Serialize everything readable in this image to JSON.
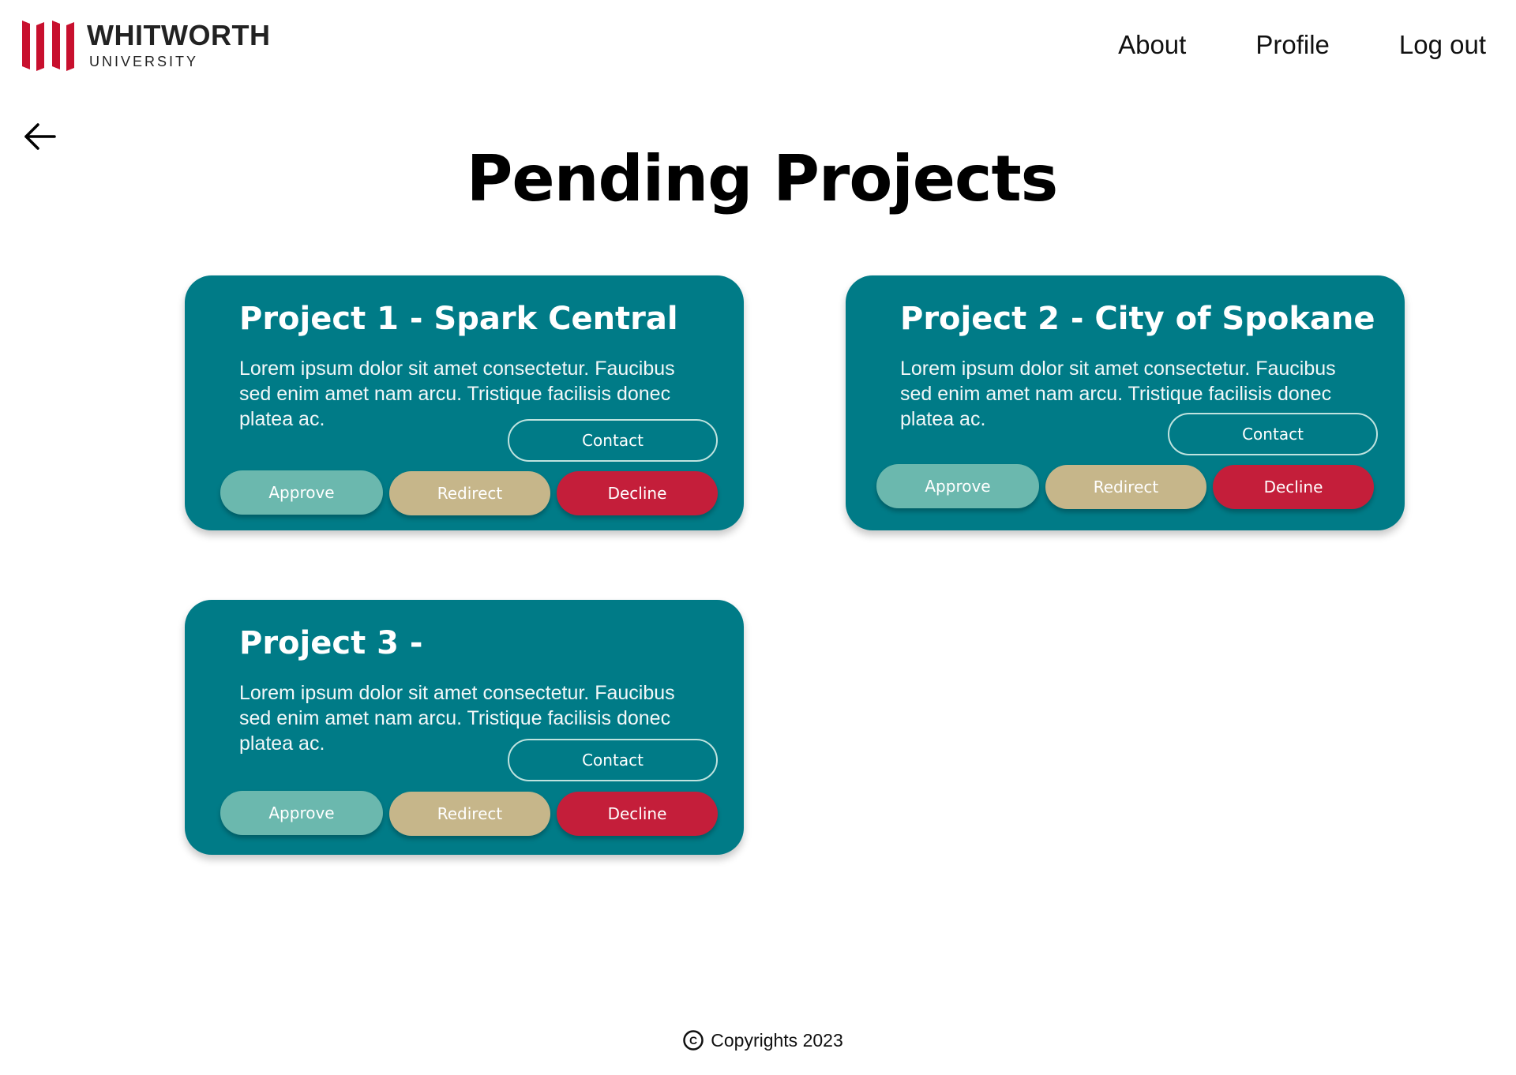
{
  "header": {
    "logo": {
      "name": "WHITWORTH",
      "subtitle": "UNIVERSITY",
      "mark_color": "#c8102e"
    },
    "nav": [
      "About",
      "Profile",
      "Log out"
    ]
  },
  "page_title": "Pending Projects",
  "colors": {
    "card_bg": "#007b87",
    "approve": "#6bb8ae",
    "redirect": "#c6b68a",
    "decline": "#c41e3a",
    "contact_border": "#bfe3df"
  },
  "projects": [
    {
      "title": "Project 1 - Spark Central",
      "description": "Lorem ipsum dolor sit amet consectetur. Faucibus sed enim amet nam arcu. Tristique facilisis donec platea ac.",
      "contact_label": "Contact",
      "approve_label": "Approve",
      "redirect_label": "Redirect",
      "decline_label": "Decline"
    },
    {
      "title": "Project 2 - City of Spokane",
      "description": "Lorem ipsum dolor sit amet consectetur. Faucibus sed enim amet nam arcu. Tristique facilisis donec platea ac.",
      "contact_label": "Contact",
      "approve_label": "Approve",
      "redirect_label": "Redirect",
      "decline_label": "Decline"
    },
    {
      "title": "Project 3 -",
      "description": "Lorem ipsum dolor sit amet consectetur. Faucibus sed enim amet nam arcu. Tristique facilisis donec platea ac.",
      "contact_label": "Contact",
      "approve_label": "Approve",
      "redirect_label": "Redirect",
      "decline_label": "Decline"
    }
  ],
  "footer": {
    "copyright_symbol": "C",
    "text": "Copyrights 2023"
  },
  "icons": {
    "back": "arrow-left-icon",
    "logo": "whitworth-logo-icon",
    "copyright": "copyright-icon"
  }
}
